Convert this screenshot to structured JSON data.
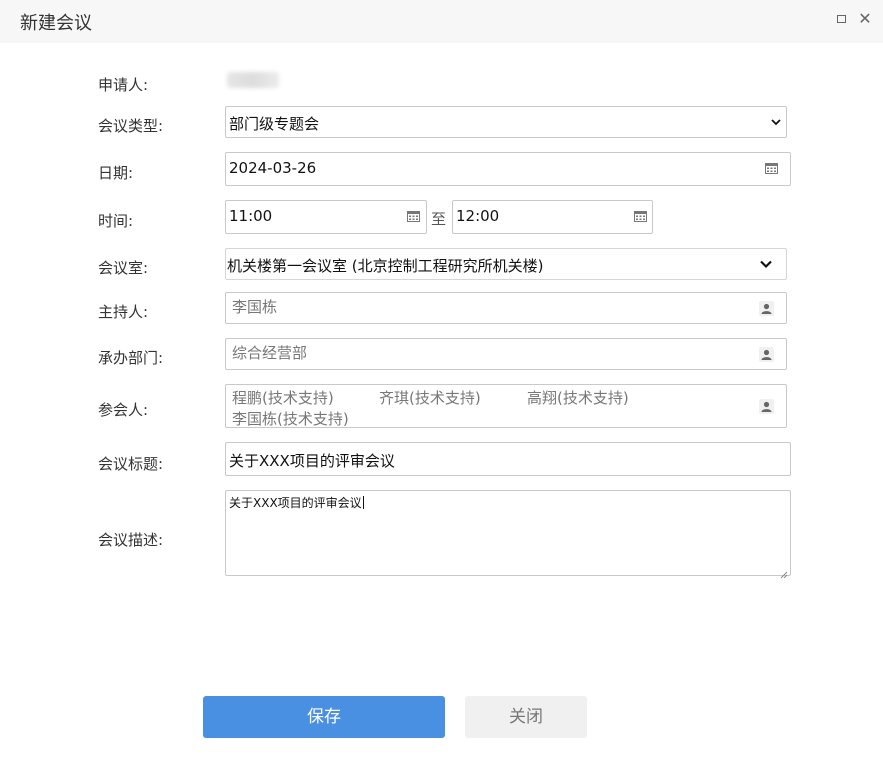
{
  "window": {
    "title": "新建会议",
    "maximize_icon": "maximize-icon",
    "close_icon": "close-icon",
    "close_glyph": "✕"
  },
  "form": {
    "applicant": {
      "label": "申请人:",
      "value": ""
    },
    "meeting_type": {
      "label": "会议类型:",
      "value": "部门级专题会"
    },
    "date": {
      "label": "日期:",
      "value": "2024-03-26"
    },
    "time": {
      "label": "时间:",
      "start": "11:00",
      "separator": "至",
      "end": "12:00"
    },
    "room": {
      "label": "会议室:",
      "value": "机关楼第一会议室 (北京控制工程研究所机关楼)"
    },
    "host": {
      "label": "主持人:",
      "value": "李国栋"
    },
    "department": {
      "label": "承办部门:",
      "value": "综合经营部"
    },
    "participants": {
      "label": "参会人:",
      "items": [
        "程鹏(技术支持)",
        "齐琪(技术支持)",
        "高翔(技术支持)",
        "李国栋(技术支持)"
      ]
    },
    "subject": {
      "label": "会议标题:",
      "value": "关于XXX项目的评审会议"
    },
    "description": {
      "label": "会议描述:",
      "value": "关于XXX项目的评审会议"
    }
  },
  "actions": {
    "save_label": "保存",
    "close_label": "关闭",
    "save_color": "#4a90e2"
  }
}
